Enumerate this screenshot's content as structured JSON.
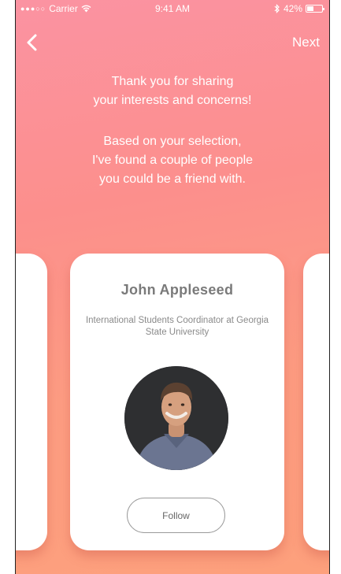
{
  "status_bar": {
    "carrier": "Carrier",
    "time": "9:41 AM",
    "battery": "42%",
    "battery_level": 0.42
  },
  "nav": {
    "back_icon": "chevron-left-icon",
    "next_label": "Next"
  },
  "intro": {
    "line1": "Thank you for sharing",
    "line2": "your interests and concerns!",
    "line3": "Based on your selection,",
    "line4": "I've found a couple of people",
    "line5": "you could be a friend with."
  },
  "profile_card": {
    "name": "John Appleseed",
    "role": "International Students Coordinator at Georgia State University",
    "follow_label": "Follow"
  },
  "colors": {
    "gradient_top": "#fb93a2",
    "gradient_bottom": "#fda07c",
    "card_bg": "#ffffff",
    "name_text": "#7a7a7a"
  }
}
